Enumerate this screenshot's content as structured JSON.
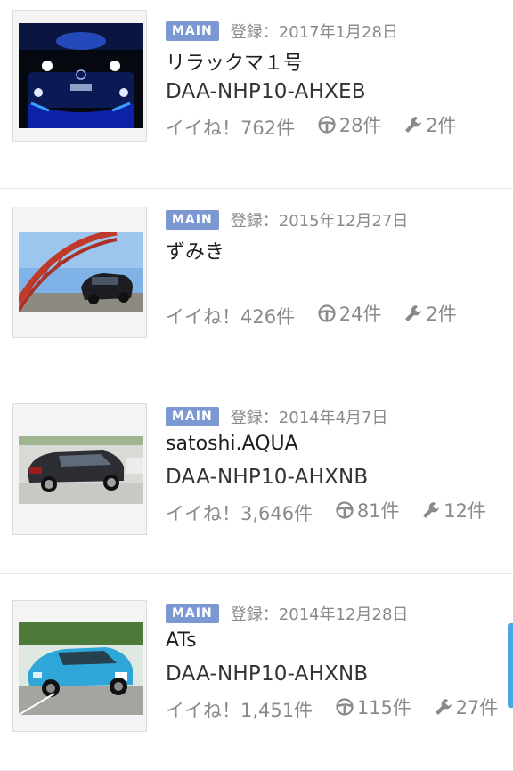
{
  "badge_label": "MAIN",
  "items": [
    {
      "registered": "登録：2017年1月28日",
      "name": "リラックマ１号",
      "model": "DAA-NHP10-AHXEB",
      "likes": "イイね！762件",
      "drives": "28件",
      "maintenance": "2件"
    },
    {
      "registered": "登録：2015年12月27日",
      "name": "ずみき",
      "model": "",
      "likes": "イイね！426件",
      "drives": "24件",
      "maintenance": "2件"
    },
    {
      "registered": "登録：2014年4月7日",
      "name": "satoshi.AQUA",
      "model": "DAA-NHP10-AHXNB",
      "likes": "イイね！3,646件",
      "drives": "81件",
      "maintenance": "12件"
    },
    {
      "registered": "登録：2014年12月28日",
      "name": "ATs",
      "model": "DAA-NHP10-AHXNB",
      "likes": "イイね！1,451件",
      "drives": "115件",
      "maintenance": "27件"
    }
  ],
  "icons": {
    "badge_color": "#7b98d2",
    "drive": "steering-wheel-icon",
    "maintenance": "wrench-icon"
  }
}
